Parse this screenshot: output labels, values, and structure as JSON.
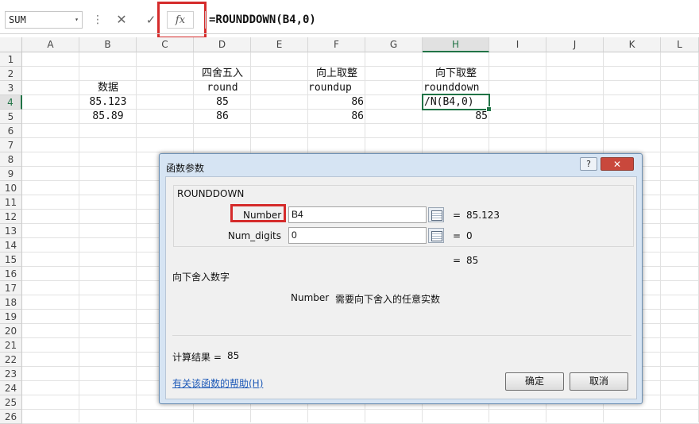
{
  "formula_bar": {
    "name_box": "SUM",
    "name_box_arrow": "▾",
    "more_dots": "⋮",
    "cancel_icon": "✕",
    "enter_icon": "✓",
    "fx_label": "fx",
    "formula": "=ROUNDDOWN(B4,0)"
  },
  "sheet": {
    "columns": [
      "A",
      "B",
      "C",
      "D",
      "E",
      "F",
      "G",
      "H",
      "I",
      "J",
      "K",
      "L"
    ],
    "selected_column": "H",
    "rows": [
      "1",
      "2",
      "3",
      "4",
      "5",
      "6",
      "7",
      "8",
      "9",
      "10",
      "11",
      "12",
      "13",
      "14",
      "15",
      "16",
      "17",
      "18",
      "19",
      "20",
      "21",
      "22",
      "23",
      "24",
      "25",
      "26"
    ],
    "selected_row": "4",
    "cells": {
      "D2": "四舍五入",
      "F2": "向上取整",
      "H2": "向下取整",
      "B3": "数据",
      "D3": "round",
      "F3": "roundup",
      "H3": "rounddown",
      "B4": "85.123",
      "D4": "85",
      "F4": "86",
      "H4": "/N(B4,0)",
      "B5": "85.89",
      "D5": "86",
      "F5": "86",
      "H5": "85"
    }
  },
  "dialog": {
    "title": "函数参数",
    "help_icon": "?",
    "close_icon": "✕",
    "function_name": "ROUNDDOWN",
    "args": [
      {
        "label": "Number",
        "value": "B4",
        "eq": "=",
        "result": "85.123"
      },
      {
        "label": "Num_digits",
        "value": "0",
        "eq": "=",
        "result": "0"
      }
    ],
    "overall_eq": "=",
    "overall_value": "85",
    "description": "向下舍入数字",
    "arg_desc_name": "Number",
    "arg_desc_text": "需要向下舍入的任意实数",
    "result_label": "计算结果 =",
    "result_value": "85",
    "help_link": "有关该函数的帮助(H)",
    "ok": "确定",
    "cancel": "取消"
  }
}
